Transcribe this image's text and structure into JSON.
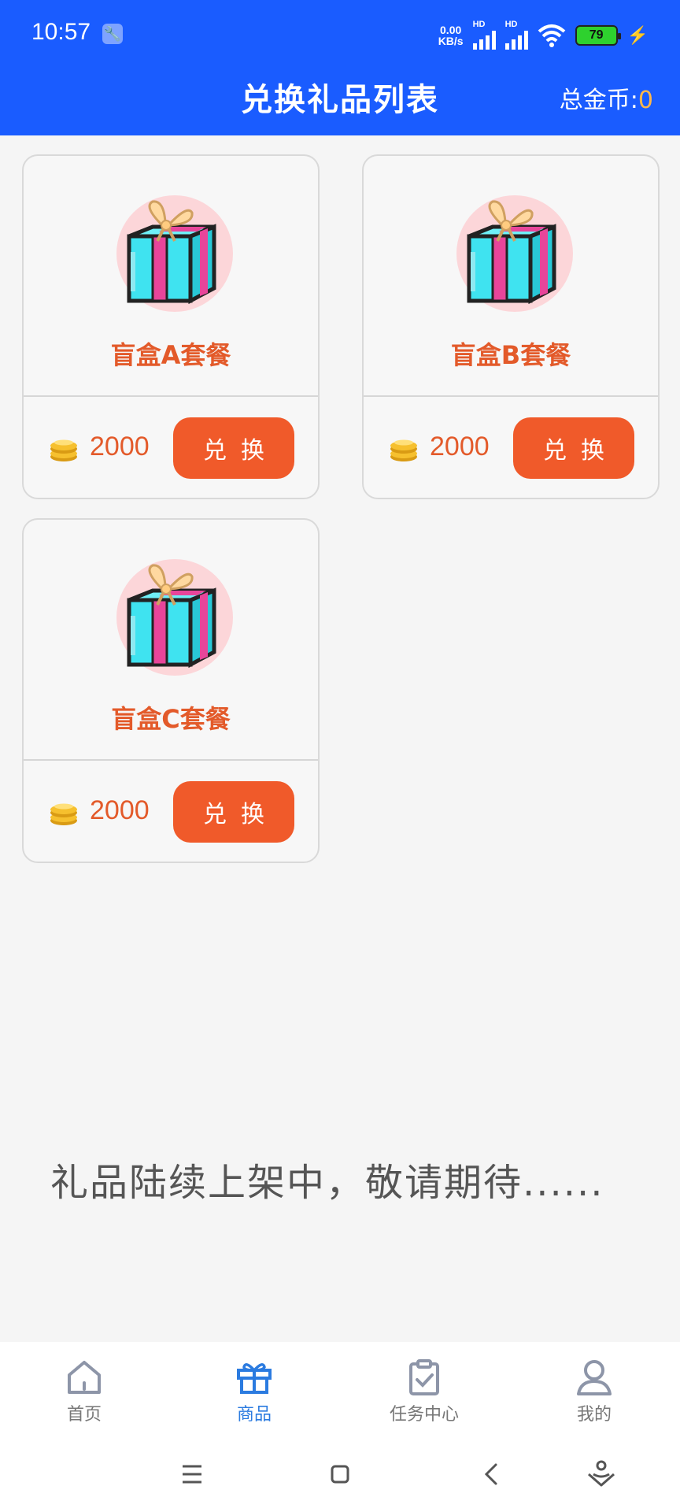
{
  "status_bar": {
    "time": "10:57",
    "net_speed_top": "0.00",
    "net_speed_bottom": "KB/s",
    "hd1": "HD",
    "hd2": "HD",
    "battery": "79",
    "icons": [
      "wrench-icon",
      "signal-icon",
      "wifi-icon",
      "battery-icon",
      "charging-icon"
    ]
  },
  "header": {
    "title": "兑换礼品列表",
    "coins_label": "总金币:",
    "coins_value": "0"
  },
  "products": [
    {
      "name": "盲盒A套餐",
      "price": "2000",
      "button": "兑换"
    },
    {
      "name": "盲盒B套餐",
      "price": "2000",
      "button": "兑换"
    },
    {
      "name": "盲盒C套餐",
      "price": "2000",
      "button": "兑换"
    }
  ],
  "notice": "礼品陆续上架中，敬请期待......",
  "bottom_nav": [
    {
      "label": "首页",
      "icon": "home-icon",
      "active": false
    },
    {
      "label": "商品",
      "icon": "gift-icon",
      "active": true
    },
    {
      "label": "任务中心",
      "icon": "task-icon",
      "active": false
    },
    {
      "label": "我的",
      "icon": "user-icon",
      "active": false
    }
  ],
  "system_nav": [
    "menu-icon",
    "home-square-icon",
    "back-icon",
    "assistant-icon"
  ],
  "colors": {
    "header_bg": "#1a5cff",
    "accent": "#f05a2a",
    "coin_value": "#ffb74a",
    "active_nav": "#2b7be0"
  }
}
